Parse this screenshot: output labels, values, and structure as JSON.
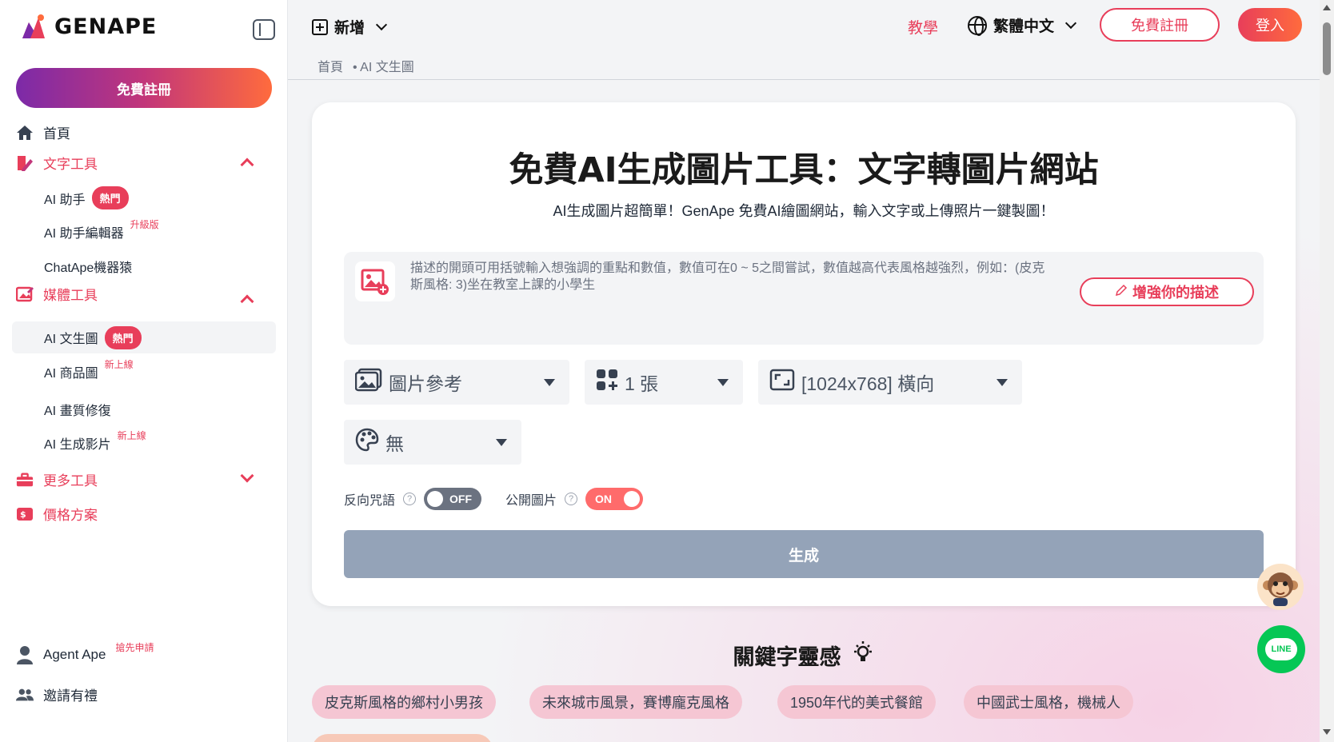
{
  "brand": {
    "name": "GENAPE"
  },
  "sidebar": {
    "signup": "免費註冊",
    "home": "首頁",
    "text_tools": "文字工具",
    "text_items": [
      {
        "label": "AI 助手",
        "badge": "熱門"
      },
      {
        "label": "AI 助手編輯器",
        "sup": "升級版"
      },
      {
        "label": "ChatApe機器猿"
      }
    ],
    "media_tools": "媒體工具",
    "media_items": [
      {
        "label": "AI 文生圖",
        "badge": "熱門"
      },
      {
        "label": "AI 商品圖",
        "sup": "新上線"
      },
      {
        "label": "AI 畫質修復"
      },
      {
        "label": "AI 生成影片",
        "sup": "新上線"
      }
    ],
    "more_tools": "更多工具",
    "pricing": "價格方案",
    "agent_ape": "Agent Ape",
    "agent_ape_sup": "搶先申請",
    "invite": "邀請有禮"
  },
  "header": {
    "new": "新增",
    "tutorial": "教學",
    "language": "繁體中文",
    "signup": "免費註冊",
    "login": "登入",
    "breadcrumb": [
      "首頁",
      "• AI 文生圖"
    ]
  },
  "main": {
    "title": "免費AI生成圖片工具：文字轉圖片網站",
    "subtitle": "AI生成圖片超簡單！GenApe 免費AI繪圖網站，輸入文字或上傳照片一鍵製圖！",
    "prompt_placeholder": "描述的開頭可用括號輸入想強調的重點和數值，數值可在0 ~ 5之間嘗試，數值越高代表風格越強烈，例如：(皮克斯風格: 3)坐在教室上課的小學生",
    "enhance": "增強你的描述",
    "select_reference": "圖片參考",
    "select_count": "1 張",
    "select_size": "[1024x768] 橫向",
    "select_style": "無",
    "negative_prompt": "反向咒語",
    "negative_state": "OFF",
    "public_image": "公開圖片",
    "public_state": "ON",
    "generate": "生成"
  },
  "keywords": {
    "title": "關鍵字靈感",
    "chips": [
      "皮克斯風格的鄉村小男孩",
      "未來城市風景，賽博龐克風格",
      "1950年代的美式餐館",
      "中國武士風格，機械人"
    ]
  },
  "widgets": {
    "line": "LINE"
  },
  "colors": {
    "accent": "#e83e5a",
    "generate_disabled": "#94a3b8",
    "line_green": "#06c755"
  }
}
